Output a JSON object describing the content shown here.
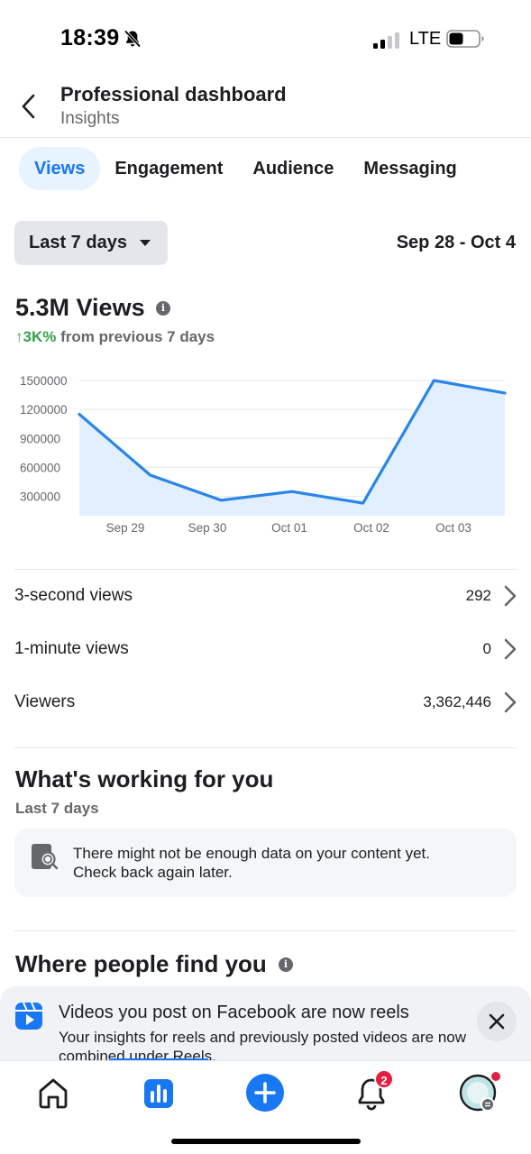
{
  "status_bar": {
    "time": "18:39",
    "network": "LTE"
  },
  "header": {
    "title": "Professional dashboard",
    "subtitle": "Insights"
  },
  "tabs": [
    {
      "label": "Views",
      "active": true
    },
    {
      "label": "Engagement",
      "active": false
    },
    {
      "label": "Audience",
      "active": false
    },
    {
      "label": "Messaging",
      "active": false
    }
  ],
  "date_filter": {
    "selected": "Last 7 days",
    "range": "Sep 28 - Oct 4"
  },
  "views": {
    "total": "5.3M Views",
    "change_value": "↑3K%",
    "change_text": " from previous 7 days"
  },
  "chart_data": {
    "type": "area",
    "x": [
      "Sep 28",
      "Sep 29",
      "Sep 30",
      "Oct 01",
      "Oct 02",
      "Oct 03",
      "Oct 04"
    ],
    "x_tick_labels": [
      "Sep 29",
      "Sep 30",
      "Oct 01",
      "Oct 02",
      "Oct 03"
    ],
    "y_tick_labels": [
      "1500000",
      "1200000",
      "900000",
      "600000",
      "300000"
    ],
    "y_ticks": [
      1500000,
      1200000,
      900000,
      600000,
      300000
    ],
    "series": [
      {
        "values": [
          1150000,
          520000,
          260000,
          350000,
          230000,
          1500000,
          1370000
        ]
      }
    ],
    "ylim": [
      100000,
      1500000
    ],
    "grid": true,
    "line_color": "#2a85e8",
    "fill_color": "#e1efff"
  },
  "metrics": [
    {
      "label": "3-second views",
      "value": "292"
    },
    {
      "label": "1-minute views",
      "value": "0"
    },
    {
      "label": "Viewers",
      "value": "3,362,446"
    }
  ],
  "whats_working": {
    "title": "What's working for you",
    "subtitle": "Last 7 days",
    "message_line1": "There might not be enough data on your content yet.",
    "message_line2": "Check back again later."
  },
  "where_people": {
    "title": "Where people find you"
  },
  "reels_notice": {
    "title": "Videos you post on Facebook are now reels",
    "body": "Your insights for reels and previously posted videos are now combined under Reels."
  },
  "bottom_nav": {
    "items": [
      "home-icon",
      "insights-icon",
      "create-icon",
      "notifications-icon",
      "profile-icon"
    ],
    "notifications_badge": "2"
  },
  "colors": {
    "accent": "#1877f2",
    "positive": "#31a24c",
    "badge": "#e41e3f"
  }
}
